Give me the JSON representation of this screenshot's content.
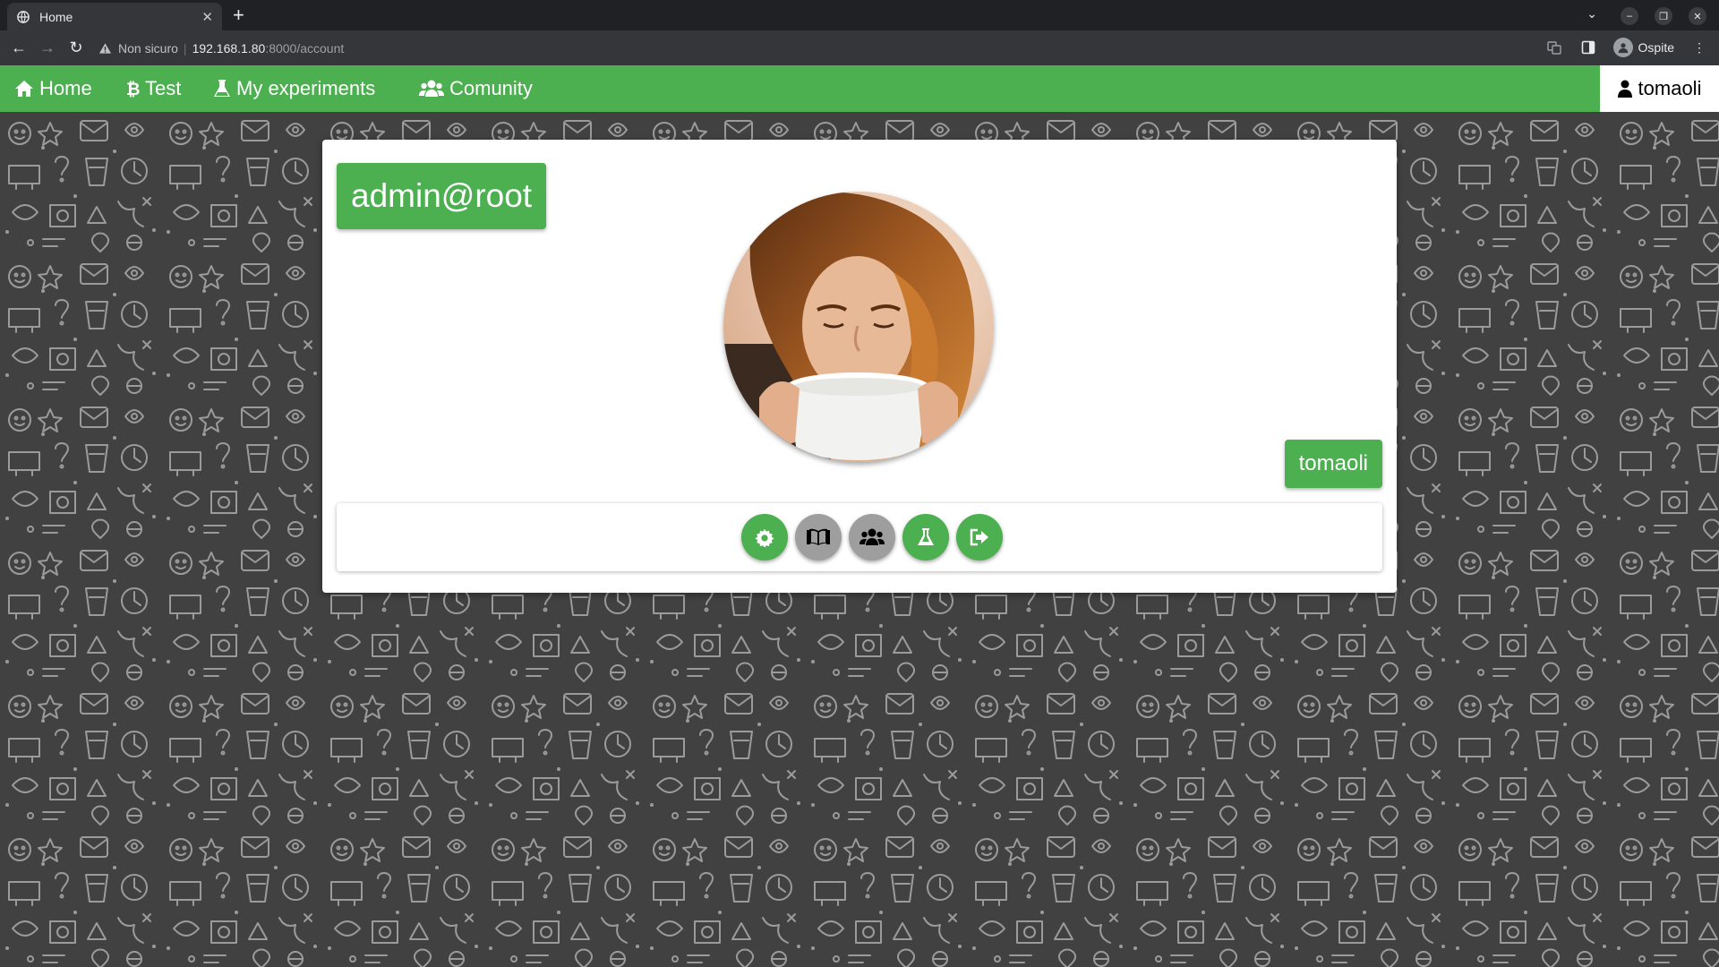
{
  "browser": {
    "tab_title": "Home",
    "security_label": "Non sicuro",
    "url_host": "192.168.1.80",
    "url_path": ":8000/account",
    "profile_label": "Ospite"
  },
  "navbar": {
    "items": [
      {
        "label": "Home",
        "icon": "home-icon"
      },
      {
        "label": "Test",
        "icon": "bitcoin-icon"
      },
      {
        "label": "My experiments",
        "icon": "flask-icon"
      },
      {
        "label": "Comunity",
        "icon": "users-icon"
      }
    ],
    "user_label": "tomaoli",
    "color": "#4caf50"
  },
  "profile": {
    "account_badge": "admin@root",
    "username_badge": "tomaoli",
    "avatar": "user-avatar-photo"
  },
  "actions": [
    {
      "name": "settings-icon",
      "color": "#4caf50"
    },
    {
      "name": "book-icon",
      "color": "#9e9e9e"
    },
    {
      "name": "users-icon",
      "color": "#9e9e9e"
    },
    {
      "name": "flask-icon",
      "color": "#4caf50"
    },
    {
      "name": "sign-out-icon",
      "color": "#4caf50"
    }
  ]
}
